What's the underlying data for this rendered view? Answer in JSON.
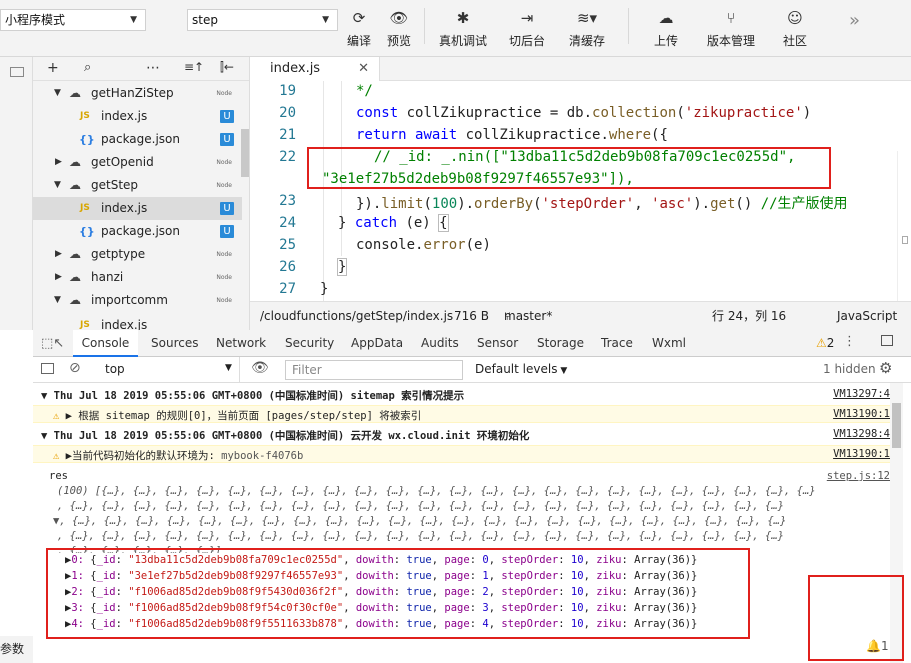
{
  "toolbar": {
    "mode_select": "小程序模式",
    "compile_select": "step",
    "buttons": [
      {
        "icon": "refresh-icon",
        "label": "编译"
      },
      {
        "icon": "eye-icon",
        "label": "预览"
      },
      {
        "icon": "bug-icon",
        "label": "真机调试"
      },
      {
        "icon": "switch-icon",
        "label": "切后台"
      },
      {
        "icon": "layers-icon",
        "label": "清缓存"
      },
      {
        "icon": "upload-cloud-icon",
        "label": "上传"
      },
      {
        "icon": "branch-icon",
        "label": "版本管理"
      },
      {
        "icon": "chat-icon",
        "label": "社区"
      }
    ],
    "more": "»"
  },
  "filetree": {
    "items": [
      {
        "label": "getHanZiStep",
        "type": "folder",
        "open": true,
        "badge": "Node"
      },
      {
        "label": "index.js",
        "type": "js",
        "badge": "U"
      },
      {
        "label": "package.json",
        "type": "json",
        "badge": "U"
      },
      {
        "label": "getOpenid",
        "type": "folder",
        "open": false,
        "badge": "Node"
      },
      {
        "label": "getStep",
        "type": "folder",
        "open": true,
        "badge": "Node"
      },
      {
        "label": "index.js",
        "type": "js",
        "badge": "U",
        "selected": true
      },
      {
        "label": "package.json",
        "type": "json",
        "badge": "U"
      },
      {
        "label": "getptype",
        "type": "folder",
        "open": false,
        "badge": "Node"
      },
      {
        "label": "hanzi",
        "type": "folder",
        "open": false,
        "badge": "Node"
      },
      {
        "label": "importcomm",
        "type": "folder",
        "open": true,
        "badge": "Node"
      },
      {
        "label": "index.js",
        "type": "js",
        "badge": ""
      }
    ]
  },
  "editor": {
    "tab": "index.js",
    "lines": [
      "19",
      "20",
      "21",
      "22",
      "",
      "23",
      "24",
      "25",
      "26",
      "27"
    ],
    "status": {
      "path": "/cloudfunctions/getStep/index.js",
      "size": "716 B",
      "branch": "master*",
      "position": "行 24，列 16",
      "language": "JavaScript"
    }
  },
  "devtools": {
    "tabs": [
      "Console",
      "Sources",
      "Network",
      "Security",
      "AppData",
      "Audits",
      "Sensor",
      "Storage",
      "Trace",
      "Wxml"
    ],
    "warn_count": "2",
    "context": "top",
    "filter_placeholder": "Filter",
    "levels": "Default levels",
    "hidden": "1 hidden",
    "log": {
      "h1": "Thu Jul 18 2019 05:55:06 GMT+0800 (中国标准时间) sitemap 索引情况提示",
      "h1_link": "VM13297:4",
      "w1": "根据 sitemap 的规则[0]，当前页面 [pages/step/step] 将被索引",
      "w1_link": "VM13190:1",
      "h2": "Thu Jul 18 2019 05:55:06 GMT+0800 (中国标准时间) 云开发 wx.cloud.init 环境初始化",
      "h2_link": "VM13298:4",
      "w2_prefix": "当前代码初始化的默认环境为:",
      "w2_env": "mybook-f4076b",
      "w2_link": "VM13190:1",
      "res_label": "res",
      "res_link": "step.js:12",
      "summary": "(100) [{…}, {…}, {…}, {…}, {…}, {…}, {…}, {…}, {…}, {…}, {…}, {…}, {…}, {…}, {…}, {…}, {…}, {…}, {…}, {…}, {…}, {…}, {…}",
      "summary_cont": ", {…}, {…}, {…}, {…}, {…}, {…}, {…}, {…}, {…}, {…}, {…}, {…}, {…}, {…}, {…}, {…}, {…}, {…}, {…}, {…}, {…}, {…}, {…}",
      "summary_tail": ", {…}, {…}, {…}, {…}, {…}]",
      "entries": [
        {
          "idx": "0",
          "id": "\"13dba11c5d2deb9b08fa709c1ec0255d\"",
          "page": "0"
        },
        {
          "idx": "1",
          "id": "\"3e1ef27b5d2deb9b08f9297f46557e93\"",
          "page": "1"
        },
        {
          "idx": "2",
          "id": "\"f1006ad85d2deb9b08f9f5430d036f2f\"",
          "page": "2"
        },
        {
          "idx": "3",
          "id": "\"f1006ad85d2deb9b08f9f54c0f30cf0e\"",
          "page": "3"
        },
        {
          "idx": "4",
          "id": "\"f1006ad85d2deb9b08f9f5511633b878\"",
          "page": "4"
        }
      ]
    },
    "bottom_left": "参数",
    "bell_count": "1"
  }
}
